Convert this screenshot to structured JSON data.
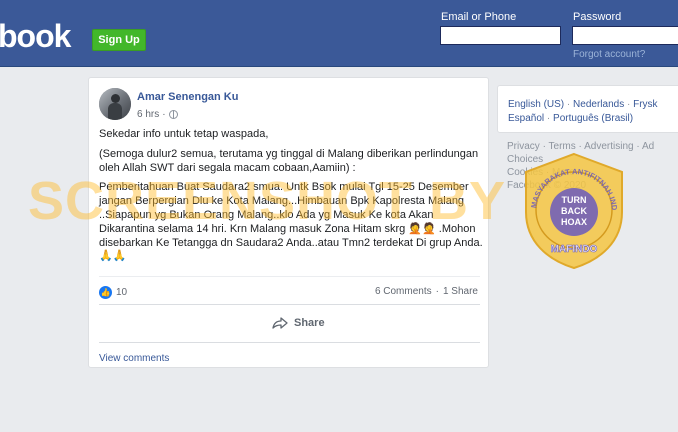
{
  "header": {
    "logo": "book",
    "signup_label": "Sign Up",
    "email_label": "Email or Phone",
    "password_label": "Password",
    "forgot_label": "Forgot account?"
  },
  "post": {
    "author": "Amar Senengan Ku",
    "time": "6 hrs",
    "dot": "·",
    "paragraphs": [
      "Sekedar info untuk tetap waspada,",
      "(Semoga dulur2 semua, terutama yg tinggal di Malang diberikan perlindungan oleh Allah SWT dari segala macam cobaan,Aamiin) :",
      "Pemberitahuan Buat Saudara2 smua. Untk Bsok mulai Tgl 15-25 Desember jangan Berpergian Dlu ke Kota Malang...Himbauan Bpk Kapolresta Malang ..Siapapun yg Bukan Orang Malang..klo Ada yg Masuk Ke kota Akan Dikarantina selama 14 hri. Krn Malang masuk Zona Hitam skrg 🤦🤦 .Mohon disebarkan Ke Tetangga dn Saudara2 Anda..atau Tmn2 terdekat Di grup Anda.🙏🙏"
    ],
    "like_count": "10",
    "comments_count": "6 Comments",
    "shares_count": "1 Share",
    "count_sep": "·",
    "share_label": "Share",
    "view_comments": "View comments"
  },
  "sidebar": {
    "languages": [
      "English (US)",
      "Nederlands",
      "Frysk",
      "Español",
      "Português (Brasil)"
    ],
    "lang_sep": "·",
    "footer_links": [
      "Privacy",
      "Terms",
      "Advertising",
      "Ad Choices",
      "Cookies",
      "More"
    ],
    "copyright": "Facebook © 2020"
  },
  "overlay": {
    "watermark": "SCREENSHOT BY",
    "badge_text_top": "TURN",
    "badge_text_mid": "BACK",
    "badge_text_bottom": "HOAX",
    "badge_ring": "MASYARAKAT ANTIFITNAH INDONESIA",
    "badge_org": "MAFINDO"
  },
  "colors": {
    "topbar": "#3b5998",
    "signup": "#42b72a",
    "link": "#385898",
    "watermark": "#ffba28",
    "badge": "#f4c542",
    "badge_inner": "#6a5bbd"
  }
}
